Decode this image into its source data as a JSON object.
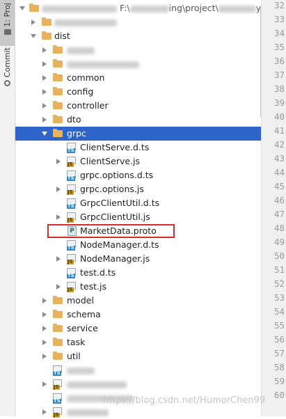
{
  "side_tabs": {
    "project_label": "1: Proj",
    "commit_label": "Commit"
  },
  "root": {
    "path_prefix": "F:\\",
    "path_middle": "ing\\project\\",
    "path_suffix": "y-a"
  },
  "tree": {
    "dist": "dist",
    "common": "common",
    "config": "config",
    "controller": "controller",
    "dto": "dto",
    "grpc": "grpc",
    "files": [
      {
        "name": "ClientServe.d.ts",
        "type": "ts",
        "expandable": false
      },
      {
        "name": "ClientServe.js",
        "type": "js",
        "expandable": true
      },
      {
        "name": "grpc.options.d.ts",
        "type": "ts",
        "expandable": false
      },
      {
        "name": "grpc.options.js",
        "type": "js",
        "expandable": true
      },
      {
        "name": "GrpcClientUtil.d.ts",
        "type": "ts",
        "expandable": false
      },
      {
        "name": "GrpcClientUtil.js",
        "type": "js",
        "expandable": true
      },
      {
        "name": "MarketData.proto",
        "type": "proto",
        "expandable": false
      },
      {
        "name": "NodeManager.d.ts",
        "type": "ts",
        "expandable": false
      },
      {
        "name": "NodeManager.js",
        "type": "js",
        "expandable": true
      },
      {
        "name": "test.d.ts",
        "type": "ts",
        "expandable": false
      },
      {
        "name": "test.js",
        "type": "js",
        "expandable": true
      }
    ],
    "model": "model",
    "schema": "schema",
    "service": "service",
    "task": "task",
    "util": "util"
  },
  "icons": {
    "ts_tag": "TS",
    "js_tag": "JS",
    "proto_tag": "P"
  },
  "line_numbers": [
    "32",
    "33",
    "34",
    "35",
    "36",
    "37",
    "38",
    "39",
    "40",
    "41",
    "42",
    "43",
    "44",
    "45",
    "46",
    "47",
    "48",
    "49",
    "50",
    "51",
    "52",
    "53",
    "54",
    "55",
    "56",
    "57",
    "58",
    "59",
    "60"
  ],
  "watermark": "https://blog.csdn.net/HumorChen99",
  "colors": {
    "selection": "#2f65ca",
    "folder": "#e9b35c",
    "highlight_box": "#d42a2a"
  }
}
